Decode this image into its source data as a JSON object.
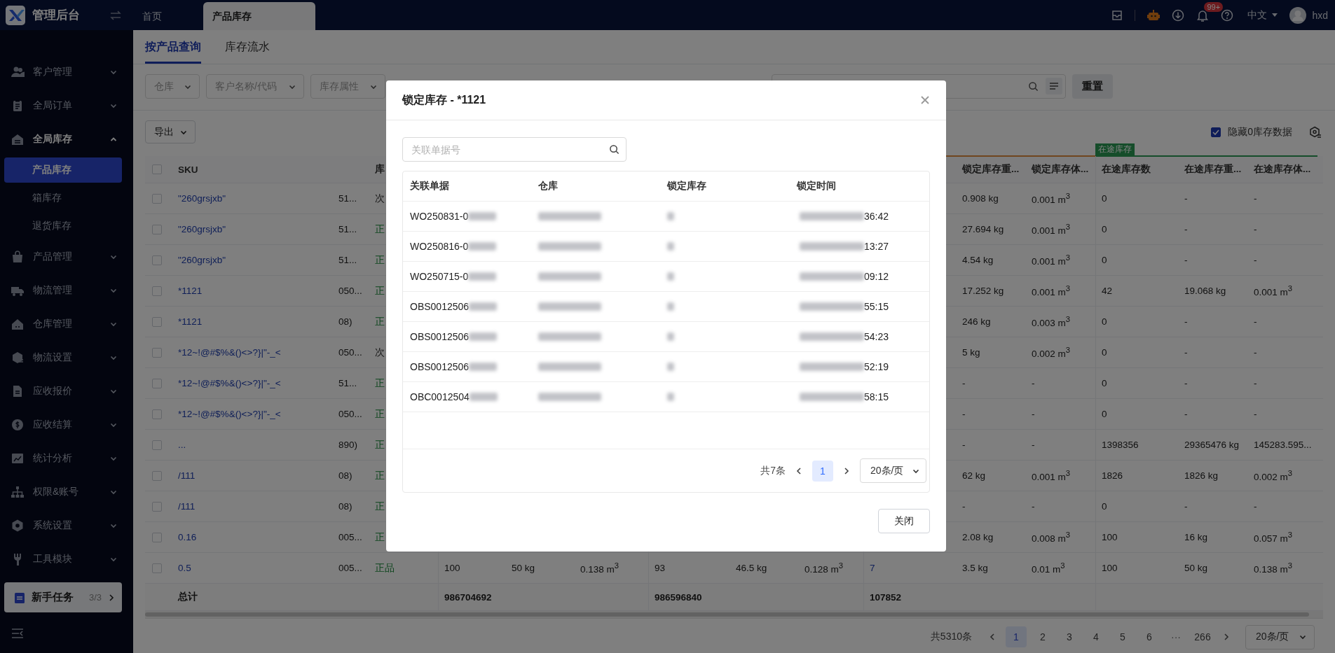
{
  "header": {
    "app_title": "管理后台",
    "tabs": [
      {
        "label": "首页",
        "selected": false
      },
      {
        "label": "产品库存",
        "selected": true
      }
    ],
    "notification_badge": "99+",
    "language": "中文",
    "user": "hxd"
  },
  "sidebar": {
    "items": [
      {
        "label": "客户管理",
        "expanded": false
      },
      {
        "label": "全局订单",
        "expanded": false
      },
      {
        "label": "全局库存",
        "expanded": true,
        "children": [
          {
            "label": "产品库存",
            "selected": true
          },
          {
            "label": "箱库存",
            "selected": false
          },
          {
            "label": "退货库存",
            "selected": false
          }
        ]
      },
      {
        "label": "产品管理",
        "expanded": false
      },
      {
        "label": "物流管理",
        "expanded": false
      },
      {
        "label": "仓库管理",
        "expanded": false
      },
      {
        "label": "物流设置",
        "expanded": false
      },
      {
        "label": "应收报价",
        "expanded": false
      },
      {
        "label": "应收结算",
        "expanded": false
      },
      {
        "label": "统计分析",
        "expanded": false
      },
      {
        "label": "权限&账号",
        "expanded": false
      },
      {
        "label": "系统设置",
        "expanded": false
      },
      {
        "label": "工具模块",
        "expanded": false
      }
    ],
    "task_card": {
      "label": "新手任务",
      "progress": "3/3"
    }
  },
  "page_tabs": [
    {
      "label": "按产品查询",
      "selected": true
    },
    {
      "label": "库存流水",
      "selected": false
    }
  ],
  "filters": [
    {
      "placeholder": "仓库"
    },
    {
      "placeholder": "客户名称/代码"
    },
    {
      "placeholder": "库存属性"
    }
  ],
  "reset_button": "重置",
  "export_button": "导出",
  "hide_zero": {
    "label": "隐藏0库存数据",
    "checked": true
  },
  "table": {
    "select_all_checked": false,
    "group_label": "在途库存",
    "columns": {
      "sku": "SKU",
      "attribute": "库",
      "locked_weight": "锁定库存重...",
      "locked_volume": "锁定库存体...",
      "in_transit_qty": "在途库存数",
      "in_transit_weight": "在途库存重...",
      "in_transit_volume": "在途库存体..."
    },
    "rows": [
      {
        "checked": false,
        "kind": "defective",
        "sku": "\"260grsjxb\"",
        "column_3": "51...",
        "attribute": "次",
        "locked_weight": "0.908 kg",
        "locked_volume": "0.001 m$^{3}$",
        "in_transit_qty": "0",
        "in_transit_weight": "-",
        "in_transit_volume": "-"
      },
      {
        "checked": false,
        "kind": "normal",
        "sku": "\"260grsjxb\"",
        "column_3": "51...",
        "attribute": "正",
        "locked_weight": "27.694 kg",
        "locked_volume": "0.001 m$^{3}$",
        "in_transit_qty": "0",
        "in_transit_weight": "-",
        "in_transit_volume": "-"
      },
      {
        "checked": false,
        "kind": "normal",
        "sku": "\"260grsjxb\"",
        "column_3": "51...",
        "attribute": "正",
        "locked_weight": "4.54 kg",
        "locked_volume": "0.001 m$^{3}$",
        "in_transit_qty": "0",
        "in_transit_weight": "-",
        "in_transit_volume": "-"
      },
      {
        "checked": false,
        "kind": "normal",
        "sku": "*1121",
        "column_3": "050...",
        "attribute": "正",
        "locked_weight": "17.252 kg",
        "locked_volume": "0.001 m$^{3}$",
        "in_transit_qty": "42",
        "in_transit_weight": "19.068 kg",
        "in_transit_volume": "0.001 m$^{3}$"
      },
      {
        "checked": false,
        "kind": "normal",
        "sku": "*1121",
        "column_3": "08)",
        "attribute": "正",
        "locked_weight": "246 kg",
        "locked_volume": "0.003 m$^{3}$",
        "in_transit_qty": "0",
        "in_transit_weight": "-",
        "in_transit_volume": "-"
      },
      {
        "checked": false,
        "kind": "defective",
        "sku": "*12~!@#$%&()<>?}|\"-_<",
        "column_3": "050...",
        "attribute": "次",
        "locked_weight": "5 kg",
        "locked_volume": "0.002 m$^{3}$",
        "in_transit_qty": "0",
        "in_transit_weight": "-",
        "in_transit_volume": "-"
      },
      {
        "checked": false,
        "kind": "normal",
        "sku": "*12~!@#$%&()<>?}|\"-_<",
        "column_3": "51...",
        "attribute": "正",
        "locked_weight": "-",
        "locked_volume": "-",
        "in_transit_qty": "0",
        "in_transit_weight": "-",
        "in_transit_volume": "-"
      },
      {
        "checked": false,
        "kind": "normal",
        "sku": "*12~!@#$%&()<>?}|\"-_<",
        "column_3": "050...",
        "attribute": "正",
        "locked_weight": "-",
        "locked_volume": "-",
        "in_transit_qty": "0",
        "in_transit_weight": "-",
        "in_transit_volume": "-"
      },
      {
        "checked": false,
        "kind": "normal",
        "sku": "...",
        "column_3": "890)",
        "attribute": "正",
        "locked_weight": "-",
        "locked_volume": "-",
        "in_transit_qty": "1398356",
        "in_transit_weight": "29365476 kg",
        "in_transit_volume": "145283.595..."
      },
      {
        "checked": false,
        "kind": "normal",
        "sku": "/111",
        "column_3": "08)",
        "attribute": "正",
        "locked_weight": "62 kg",
        "locked_volume": "0.001 m$^{3}$",
        "in_transit_qty": "1826",
        "in_transit_weight": "1826 kg",
        "in_transit_volume": "0.002 m$^{3}$"
      },
      {
        "checked": false,
        "kind": "normal",
        "sku": "/111",
        "column_3": "08)",
        "attribute": "正",
        "locked_weight": "-",
        "locked_volume": "-",
        "in_transit_qty": "0",
        "in_transit_weight": "-",
        "in_transit_volume": "-"
      },
      {
        "checked": false,
        "kind": "normal",
        "sku": "0.16",
        "column_3": "005...",
        "attribute": "正",
        "locked_weight": "2.08 kg",
        "locked_volume": "0.008 m$^{3}$",
        "in_transit_qty": "100",
        "in_transit_weight": "16 kg",
        "in_transit_volume": "0.057 m$^{3}$"
      },
      {
        "checked": false,
        "kind": "normal",
        "sku": "0.5",
        "column_3": "005...",
        "attribute": "正品",
        "middle": [
          "100",
          "50 kg",
          "0.138 m$^{3}$",
          "93",
          "46.5 kg",
          "0.128 m$^{3}$",
          "7"
        ],
        "locked_weight": "3.5 kg",
        "locked_volume": "0.01 m$^{3}$",
        "in_transit_qty": "100",
        "in_transit_weight": "50 kg",
        "in_transit_volume": "0.138 m$^{3}$"
      }
    ],
    "total": {
      "label": "总计",
      "values": [
        "986704692",
        "986596840",
        "107852"
      ]
    }
  },
  "pagination": {
    "total": "共5310条",
    "pages": [
      {
        "label": "1",
        "kind": "page",
        "selected": true
      },
      {
        "label": "2",
        "kind": "page",
        "selected": false
      },
      {
        "label": "3",
        "kind": "page",
        "selected": false
      },
      {
        "label": "4",
        "kind": "page",
        "selected": false
      },
      {
        "label": "5",
        "kind": "page",
        "selected": false
      },
      {
        "label": "6",
        "kind": "page",
        "selected": false
      },
      {
        "label": "···",
        "kind": "ellipsis",
        "selected": false
      },
      {
        "label": "266",
        "kind": "page",
        "selected": false
      }
    ],
    "page_size": "20条/页"
  },
  "modal": {
    "title": "锁定库存 - *1121",
    "search_placeholder": "关联单据号",
    "columns": [
      "关联单据",
      "仓库",
      "锁定库存",
      "锁定时间"
    ],
    "rows": [
      {
        "document": "WO250831-0",
        "time": "36:42"
      },
      {
        "document": "WO250816-0",
        "time": "13:27"
      },
      {
        "document": "WO250715-0",
        "time": "09:12"
      },
      {
        "document": "OBS0012506",
        "time": "55:15"
      },
      {
        "document": "OBS0012506",
        "time": "54:23"
      },
      {
        "document": "OBS0012506",
        "time": "52:19"
      },
      {
        "document": "OBC0012504",
        "time": "58:15"
      }
    ],
    "total": "共7条",
    "pages": [
      {
        "label": "1",
        "selected": true
      }
    ],
    "page_size": "20条/页",
    "close_button": "关闭"
  }
}
